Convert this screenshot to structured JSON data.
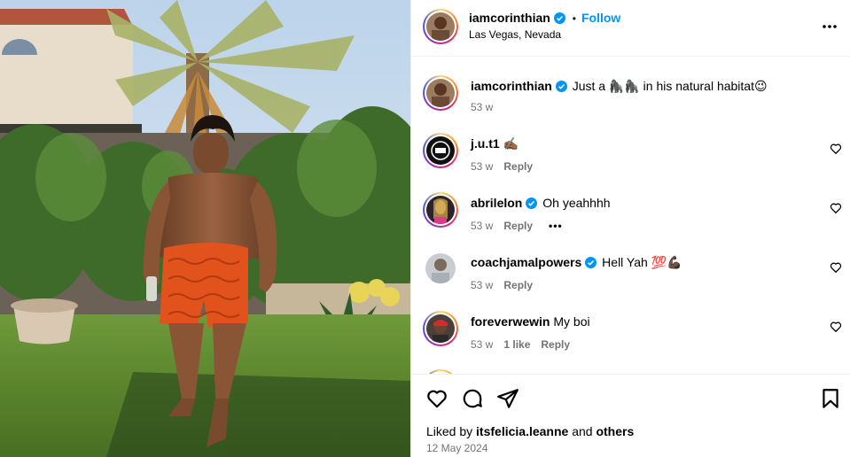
{
  "media": {
    "alt_icon": "photo-man-in-garden"
  },
  "header": {
    "username": "iamcorinthian",
    "dot": "•",
    "follow_label": "Follow",
    "location": "Las Vegas, Nevada"
  },
  "caption": {
    "username": "iamcorinthian",
    "text": "Just a 🦍🦍 in his natural habitat😉",
    "time": "53 w"
  },
  "comments": [
    {
      "username": "j.u.t1",
      "text": "✍🏾",
      "time": "53 w",
      "reply": "Reply",
      "likes": ""
    },
    {
      "username": "abrilelon",
      "text": "Oh yeahhhh",
      "time": "53 w",
      "reply": "Reply",
      "likes": ""
    },
    {
      "username": "coachjamalpowers",
      "text": "Hell Yah 💯💪🏿",
      "time": "53 w",
      "reply": "Reply",
      "likes": ""
    },
    {
      "username": "foreverwewin",
      "text": "My boi",
      "time": "53 w",
      "reply": "Reply",
      "likes": "1 like"
    }
  ],
  "footer": {
    "liked_prefix": "Liked by",
    "liked_user": "itsfelicia.leanne",
    "liked_and": "and",
    "liked_others": "others",
    "date": "12 May 2024"
  },
  "colors": {
    "accent": "#0095f6",
    "verified": "#0095f6",
    "muted": "#737373"
  }
}
